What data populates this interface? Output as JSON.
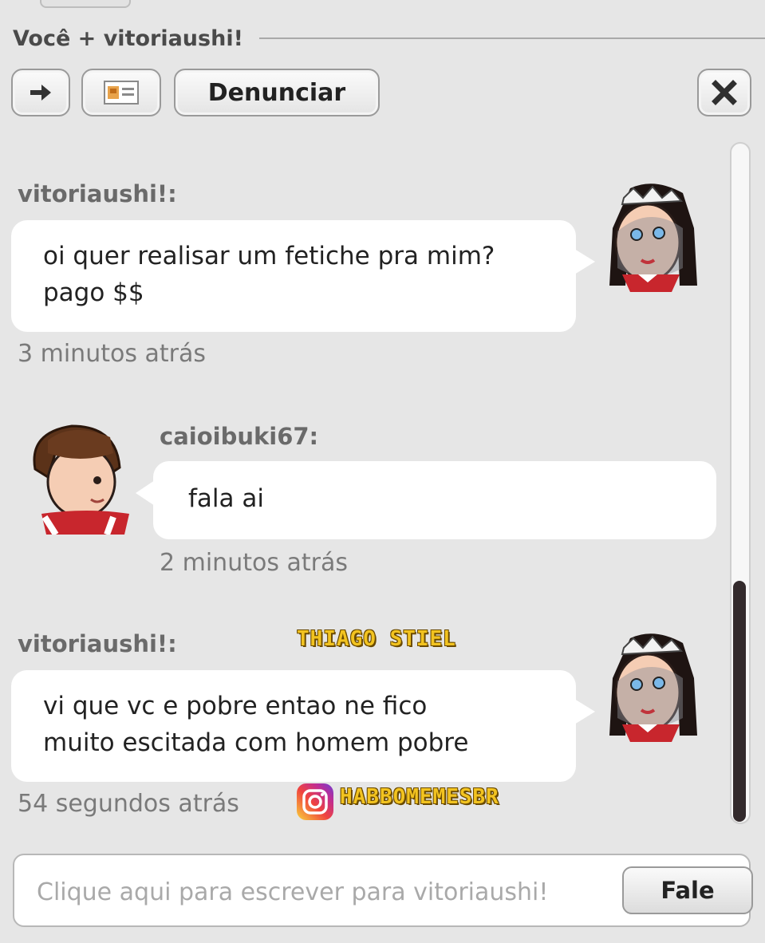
{
  "window": {
    "title": "Você + vitoriaushi!"
  },
  "toolbar": {
    "go_icon": "arrow-right-icon",
    "profile_icon": "profile-card-icon",
    "report_label": "Denunciar",
    "close_icon": "close-x-icon"
  },
  "messages": [
    {
      "sender": "vitoriaushi!:",
      "line1": "oi quer realisar um fetiche pra mim?",
      "line2": "pago $$",
      "time": "3 minutos atrás",
      "side": "left"
    },
    {
      "sender": "caioibuki67:",
      "line1": "fala ai",
      "time": "2 minutos atrás",
      "side": "right"
    },
    {
      "sender": "vitoriaushi!:",
      "line1": "vi que vc e pobre entao ne fico",
      "line2": "muito escitada com homem pobre",
      "time": "54 segundos atrás",
      "side": "left"
    }
  ],
  "watermarks": {
    "credit": "THIAGO STIEL",
    "instagram": "HABBOMEMESBR"
  },
  "composer": {
    "placeholder": "Clique aqui para escrever para vitoriaushi!",
    "send_label": "Fale"
  },
  "colors": {
    "background": "#e6e6e6",
    "bubble": "#ffffff",
    "scroll_thumb": "#332a2c"
  }
}
